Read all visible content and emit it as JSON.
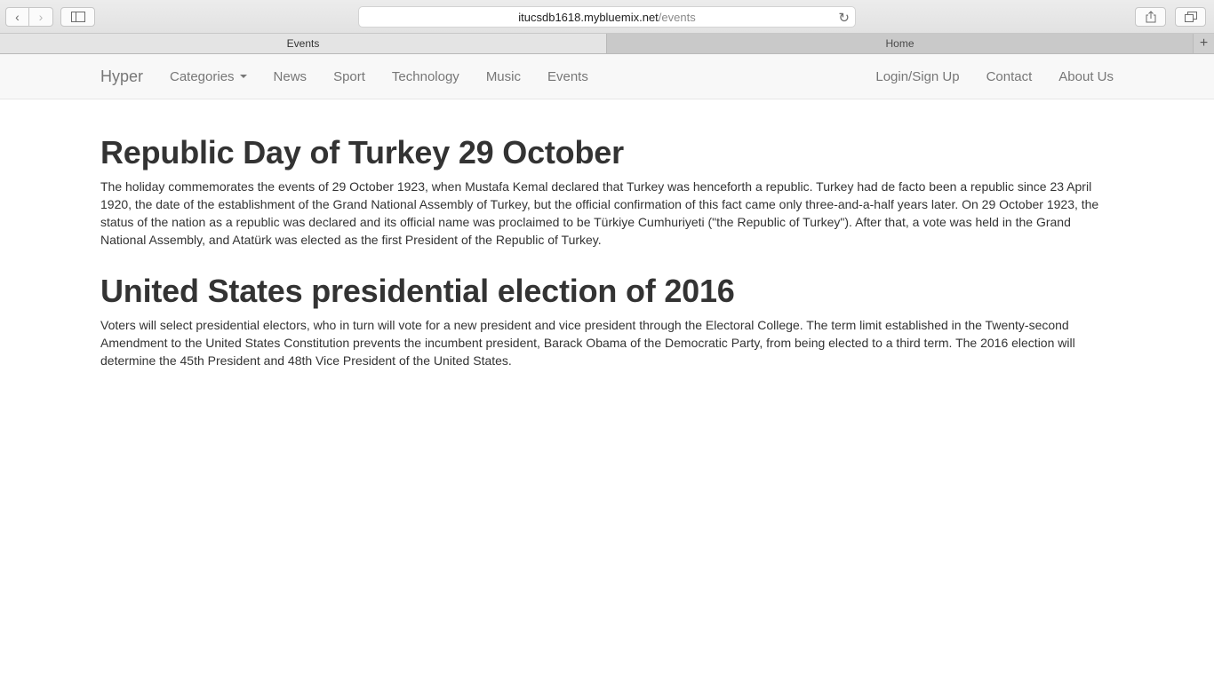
{
  "browser": {
    "url_host": "itucsdb1618.mybluemix.net",
    "url_path": "/events",
    "tabs": [
      {
        "label": "Events",
        "active": true
      },
      {
        "label": "Home",
        "active": false
      }
    ]
  },
  "navbar": {
    "brand": "Hyper",
    "left_items": [
      "Categories",
      "News",
      "Sport",
      "Technology",
      "Music",
      "Events"
    ],
    "right_items": [
      "Login/Sign Up",
      "Contact",
      "About Us"
    ]
  },
  "events": [
    {
      "title": "Republic Day of Turkey 29 October",
      "body": "The holiday commemorates the events of 29 October 1923, when Mustafa Kemal declared that Turkey was henceforth a republic. Turkey had de facto been a republic since 23 April 1920, the date of the establishment of the Grand National Assembly of Turkey, but the official confirmation of this fact came only three-and-a-half years later. On 29 October 1923, the status of the nation as a republic was declared and its official name was proclaimed to be Türkiye Cumhuriyeti (\"the Republic of Turkey\"). After that, a vote was held in the Grand National Assembly, and Atatürk was elected as the first President of the Republic of Turkey."
    },
    {
      "title": "United States presidential election of 2016",
      "body": "Voters will select presidential electors, who in turn will vote for a new president and vice president through the Electoral College. The term limit established in the Twenty-second Amendment to the United States Constitution prevents the incumbent president, Barack Obama of the Democratic Party, from being elected to a third term. The 2016 election will determine the 45th President and 48th Vice President of the United States."
    }
  ]
}
